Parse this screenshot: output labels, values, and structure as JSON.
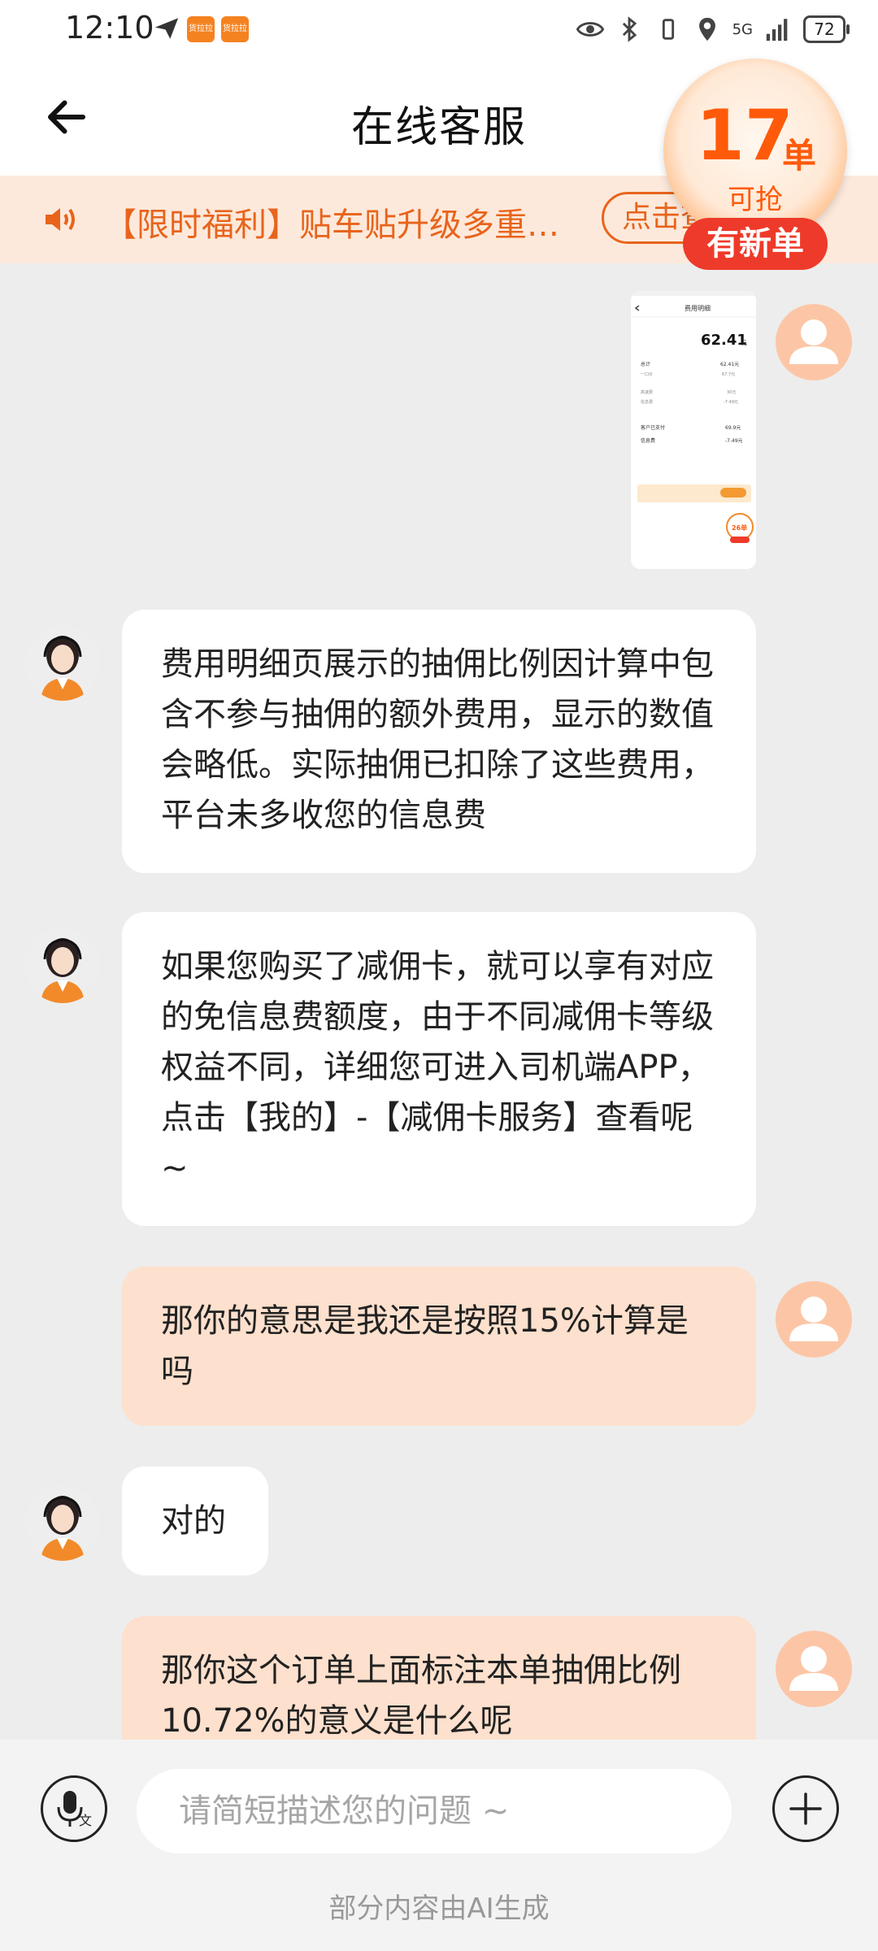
{
  "status_bar": {
    "time": "12:10",
    "app_badge": "货拉拉",
    "network": "5G",
    "battery": "72"
  },
  "header": {
    "title": "在线客服"
  },
  "notice": {
    "text": "【限时福利】贴车贴升级多重…",
    "button": "点击查"
  },
  "orders_widget": {
    "count": "17",
    "unit": "单",
    "sub": "可抢",
    "tag": "有新单"
  },
  "screenshot_thumb": {
    "title": "费用明细",
    "total": "62.41",
    "total_unit": "元",
    "rows": [
      {
        "label": "总计",
        "value": "62.41元"
      },
      {
        "label": "一口价",
        "value": "67.7元"
      },
      {
        "label": "高速费",
        "value": "30元"
      },
      {
        "label": "信息费",
        "value": "-7.49元"
      },
      {
        "label": "客户已支付",
        "value": "69.9元"
      },
      {
        "label": "信息费",
        "value": "-7.49元"
      }
    ],
    "badge": "26单"
  },
  "messages": [
    {
      "from": "agent",
      "text": "费用明细页展示的抽佣比例因计算中包含不参与抽佣的额外费用，显示的数值会略低。实际抽佣已扣除了这些费用，平台未多收您的信息费"
    },
    {
      "from": "agent",
      "text": "如果您购买了减佣卡，就可以享有对应的免信息费额度，由于不同减佣卡等级权益不同，详细您可进入司机端APP，点击【我的】-【减佣卡服务】查看呢~"
    },
    {
      "from": "user",
      "text": "那你的意思是我还是按照15%计算是吗"
    },
    {
      "from": "agent",
      "text": "对的"
    },
    {
      "from": "user",
      "text": "那你这个订单上面标注本单抽佣比例10.72%的意义是什么呢"
    }
  ],
  "input": {
    "placeholder": "请简短描述您的问题 ~"
  },
  "footer": {
    "ai_note": "部分内容由AI生成"
  },
  "colors": {
    "accent": "#e8641c",
    "user_bubble": "#fde0cd",
    "notice_bg": "#fde9db",
    "tag_red": "#ee3a2a"
  }
}
